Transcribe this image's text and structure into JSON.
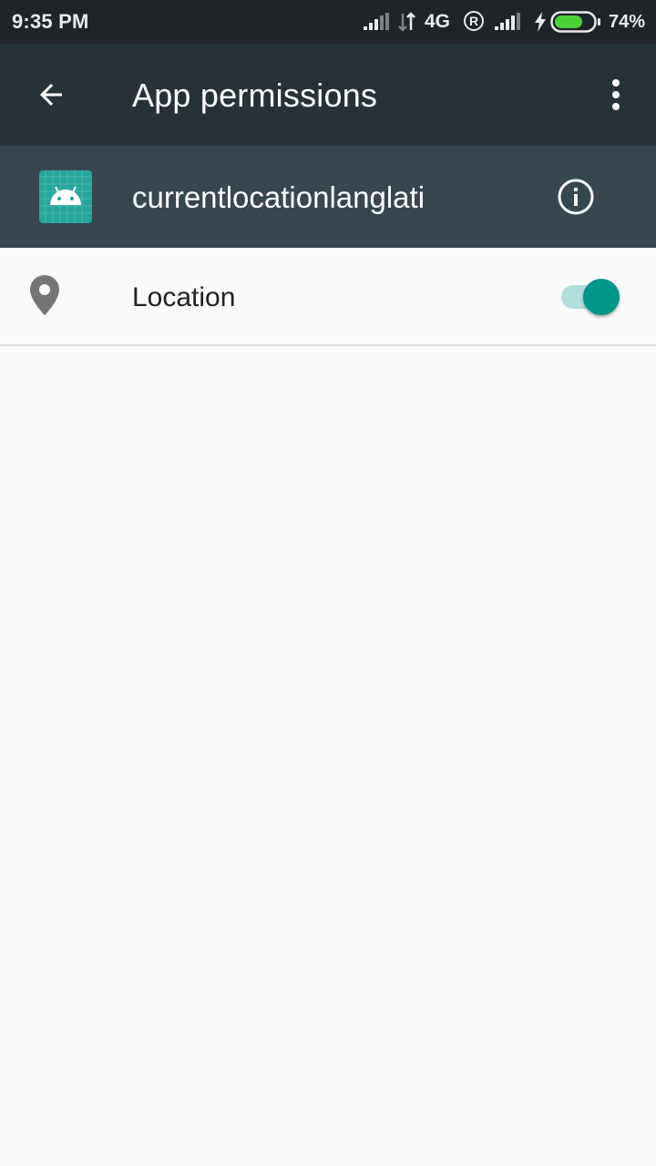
{
  "status_bar": {
    "time": "9:35 PM",
    "network_type": "4G",
    "roaming_indicator": "R",
    "battery_percent": "74%",
    "battery_level": 0.74,
    "icons": [
      "signal-icon",
      "data-arrows-icon",
      "roaming-icon",
      "signal-icon-2",
      "charging-icon",
      "battery-icon"
    ]
  },
  "app_bar": {
    "title": "App permissions",
    "back_icon": "arrow-back-icon",
    "overflow_icon": "more-vert-icon"
  },
  "app_header": {
    "app_name": "currentlocationlanglati",
    "app_icon": "android-app-icon",
    "info_icon": "info-icon"
  },
  "permissions": [
    {
      "label": "Location",
      "icon": "location-pin-icon",
      "enabled": true
    }
  ],
  "colors": {
    "status_bar_bg": "#1f2429",
    "app_bar_bg": "#263238",
    "header_bg": "#37474f",
    "page_bg": "#fafafa",
    "accent": "#009688",
    "accent_light": "#b2dfdb"
  }
}
